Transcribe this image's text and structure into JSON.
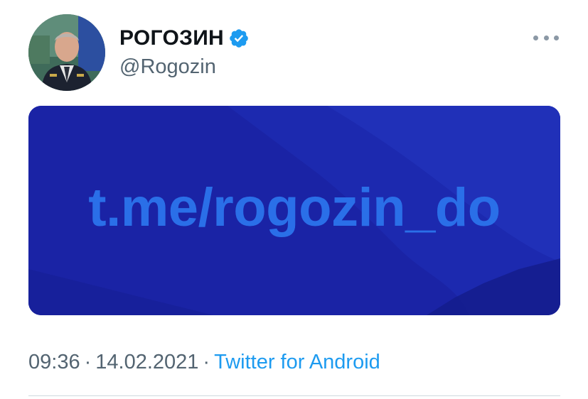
{
  "author": {
    "display_name": "РОГОЗИН",
    "handle": "@Rogozin",
    "verified": true,
    "avatar_icon": "profile-photo"
  },
  "card": {
    "text": "t.me/rogozin_do",
    "background_color": "#1a23a5",
    "text_color": "#2a6fe8"
  },
  "meta": {
    "time": "09:36",
    "date": "14.02.2021",
    "separator": "·",
    "source": "Twitter for Android"
  },
  "more_icon": "more-horizontal-icon",
  "colors": {
    "accent": "#1d9bf0",
    "secondary_text": "#536471",
    "primary_text": "#0f1419"
  }
}
